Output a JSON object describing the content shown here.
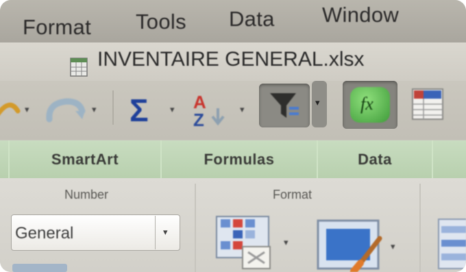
{
  "menubar": {
    "items": [
      "Format",
      "Tools",
      "Data",
      "Window"
    ]
  },
  "titlebar": {
    "title": "INVENTAIRE GENERAL.xlsx"
  },
  "toolbar": {
    "icons": [
      "undo-icon",
      "redo-icon",
      "autosum-icon",
      "sort-icon",
      "filter-icon",
      "formula-builder-icon",
      "gallery-icon"
    ],
    "autosum_symbol": "Σ",
    "formula_symbol": "fx"
  },
  "ribbon": {
    "tabs": [
      "SmartArt",
      "Formulas",
      "Data"
    ],
    "groups": {
      "number": {
        "label": "Number",
        "format_value": "General"
      },
      "format": {
        "label": "Format"
      }
    }
  },
  "colors": {
    "menubar": "#aeaba3",
    "ribbon_tabs": "#bfd5b5",
    "accent_green": "#3f9b3a",
    "autosum_blue": "#1d3f9a"
  }
}
